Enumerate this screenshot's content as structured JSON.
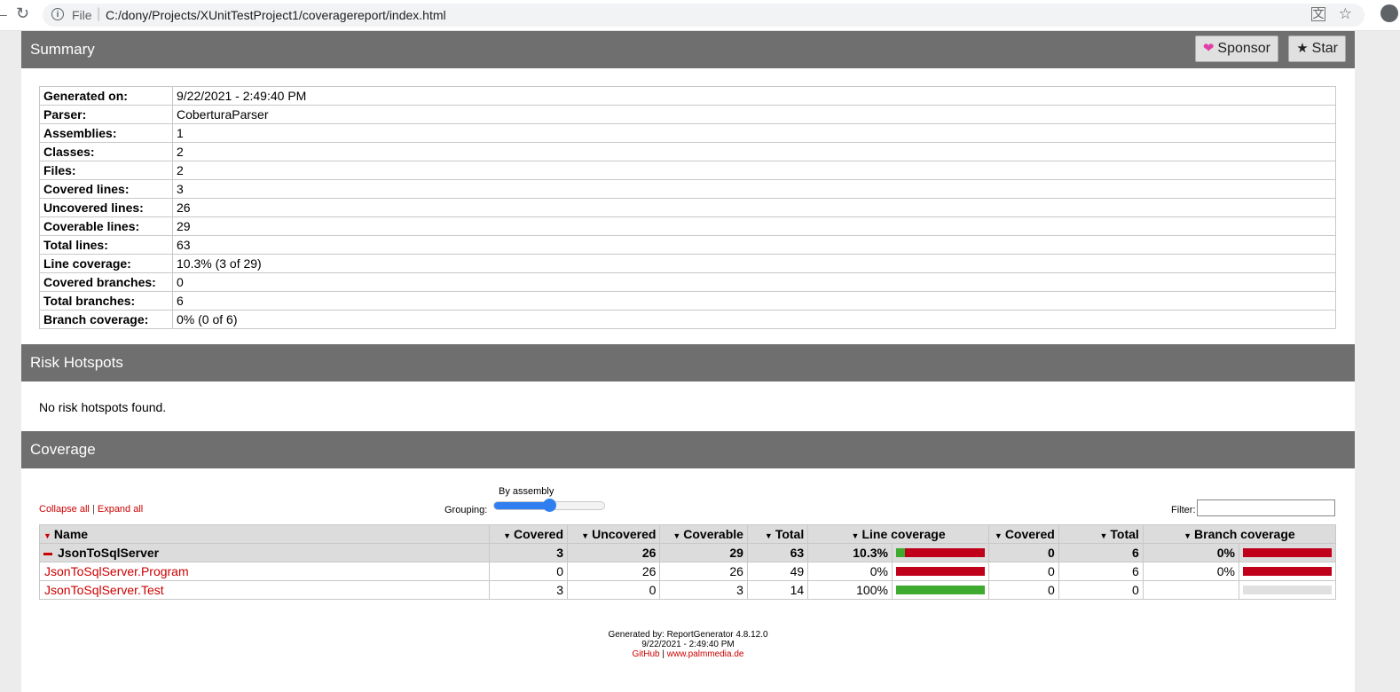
{
  "browser": {
    "scheme": "File",
    "url": "C:/dony/Projects/XUnitTestProject1/coveragereport/index.html"
  },
  "summary": {
    "title": "Summary",
    "sponsor_label": "Sponsor",
    "star_label": "Star",
    "rows": [
      {
        "label": "Generated on:",
        "value": "9/22/2021 - 2:49:40 PM"
      },
      {
        "label": "Parser:",
        "value": "CoberturaParser"
      },
      {
        "label": "Assemblies:",
        "value": "1"
      },
      {
        "label": "Classes:",
        "value": "2"
      },
      {
        "label": "Files:",
        "value": "2"
      },
      {
        "label": "Covered lines:",
        "value": "3"
      },
      {
        "label": "Uncovered lines:",
        "value": "26"
      },
      {
        "label": "Coverable lines:",
        "value": "29"
      },
      {
        "label": "Total lines:",
        "value": "63"
      },
      {
        "label": "Line coverage:",
        "value": "10.3% (3 of 29)"
      },
      {
        "label": "Covered branches:",
        "value": "0"
      },
      {
        "label": "Total branches:",
        "value": "6"
      },
      {
        "label": "Branch coverage:",
        "value": "0% (0 of 6)"
      }
    ]
  },
  "risk": {
    "title": "Risk Hotspots",
    "message": "No risk hotspots found."
  },
  "coverage": {
    "title": "Coverage",
    "collapse_label": "Collapse all",
    "expand_label": "Expand all",
    "separator": "|",
    "grouping_label": "Grouping:",
    "grouping_value": "By assembly",
    "grouping_level": 0.5,
    "filter_label": "Filter:",
    "filter_value": "",
    "columns": [
      "Name",
      "Covered",
      "Uncovered",
      "Coverable",
      "Total",
      "Line coverage",
      "Covered",
      "Total",
      "Branch coverage"
    ],
    "colors": {
      "covered": "#3eaa2f",
      "uncovered": "#c0001a",
      "empty": "#e0e0e0",
      "link": "#cc0000"
    },
    "rows": [
      {
        "name": "JsonToSqlServer",
        "kind": "assembly",
        "covered": "3",
        "uncovered": "26",
        "coverable": "29",
        "total": "63",
        "line_pct": "10.3%",
        "line_ratio": 0.103,
        "bcovered": "0",
        "btotal": "6",
        "branch_pct": "0%",
        "branch_ratio": 0
      },
      {
        "name": "JsonToSqlServer.Program",
        "kind": "class",
        "covered": "0",
        "uncovered": "26",
        "coverable": "26",
        "total": "49",
        "line_pct": "0%",
        "line_ratio": 0,
        "bcovered": "0",
        "btotal": "6",
        "branch_pct": "0%",
        "branch_ratio": 0
      },
      {
        "name": "JsonToSqlServer.Test",
        "kind": "class",
        "covered": "3",
        "uncovered": "0",
        "coverable": "3",
        "total": "14",
        "line_pct": "100%",
        "line_ratio": 1,
        "bcovered": "0",
        "btotal": "0",
        "branch_pct": "",
        "branch_ratio": null
      }
    ]
  },
  "footer": {
    "generated_by": "Generated by: ReportGenerator 4.8.12.0",
    "date": "9/22/2021 - 2:49:40 PM",
    "github": "GitHub",
    "separator": "|",
    "website": "www.palmmedia.de"
  }
}
